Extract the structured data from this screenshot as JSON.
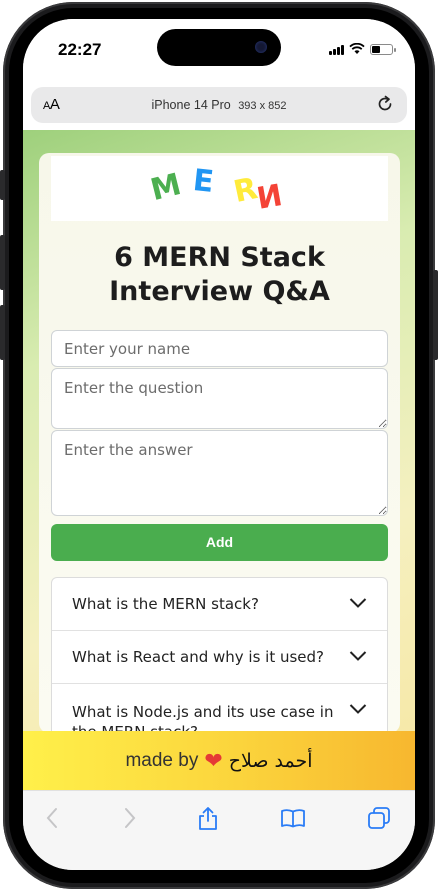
{
  "status_bar": {
    "time": "22:27"
  },
  "url_bar": {
    "text_size_label": "AA",
    "device_name": "iPhone 14 Pro",
    "device_dims": "393 x 852"
  },
  "logo": {
    "letters": [
      "M",
      "E",
      "R",
      "N"
    ],
    "colors": [
      "#4caf50",
      "#2196f3",
      "#ffeb3b",
      "#f44336"
    ]
  },
  "page": {
    "title": "6 MERN Stack Interview Q&A",
    "form": {
      "name_placeholder": "Enter your name",
      "question_placeholder": "Enter the question",
      "answer_placeholder": "Enter the answer",
      "add_label": "Add"
    },
    "questions": [
      "What is the MERN stack?",
      "What is React and why is it used?",
      "What is Node.js and its use case in the MERN stack?"
    ]
  },
  "footer": {
    "made_by": "made by",
    "author": "أحمد صلاح"
  },
  "colors": {
    "accent_green": "#4aad4e",
    "footer_yellow": "#fbd43c",
    "heart_red": "#e53935"
  },
  "toolbar": {
    "icons": [
      "back-icon",
      "forward-icon",
      "share-icon",
      "bookmarks-icon",
      "tabs-icon"
    ]
  }
}
